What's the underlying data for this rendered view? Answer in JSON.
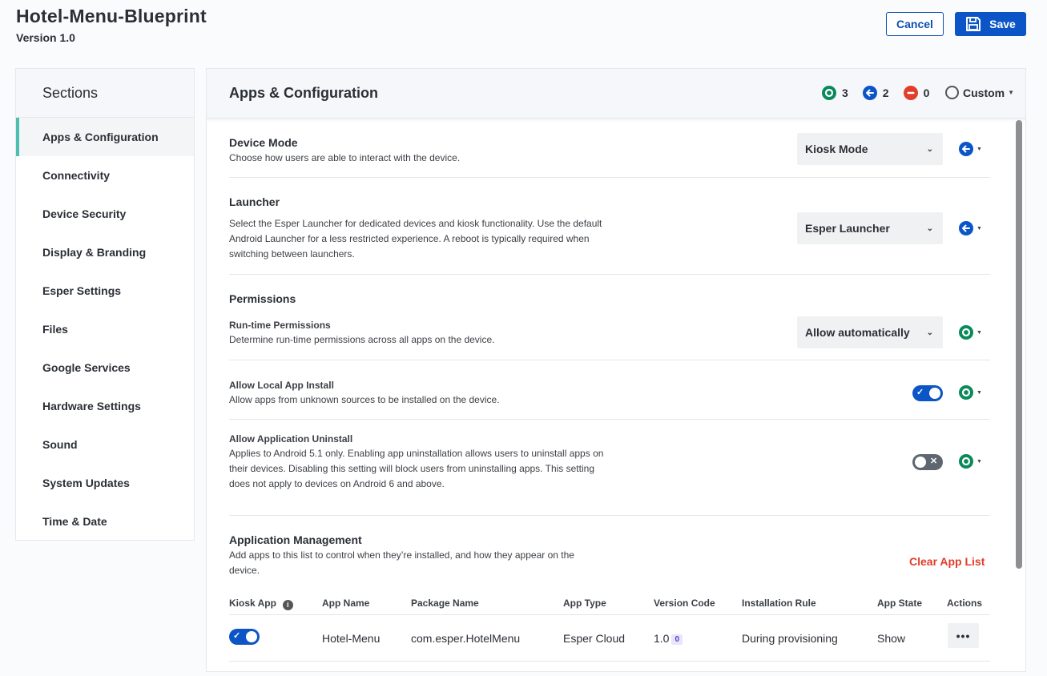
{
  "header": {
    "title": "Hotel-Menu-Blueprint",
    "version": "Version 1.0",
    "cancel_label": "Cancel",
    "save_label": "Save"
  },
  "sidebar": {
    "title": "Sections",
    "items": [
      {
        "label": "Apps & Configuration",
        "active": true
      },
      {
        "label": "Connectivity"
      },
      {
        "label": "Device Security"
      },
      {
        "label": "Display & Branding"
      },
      {
        "label": "Esper Settings"
      },
      {
        "label": "Files"
      },
      {
        "label": "Google Services"
      },
      {
        "label": "Hardware Settings"
      },
      {
        "label": "Sound"
      },
      {
        "label": "System Updates"
      },
      {
        "label": "Time & Date"
      }
    ]
  },
  "main": {
    "title": "Apps & Configuration",
    "counts": {
      "green": "3",
      "blue": "2",
      "red": "0"
    },
    "custom_label": "Custom",
    "device_mode": {
      "title": "Device Mode",
      "desc": "Choose how users are able to interact with the device.",
      "value": "Kiosk Mode",
      "status": "blue-arrow-icon"
    },
    "launcher": {
      "title": "Launcher",
      "desc": "Select the Esper Launcher for dedicated devices and kiosk functionality. Use the default Android Launcher for a less restricted experience. A reboot is typically required when switching between launchers.",
      "value": "Esper Launcher",
      "status": "blue-arrow-icon"
    },
    "permissions": {
      "title": "Permissions",
      "runtime": {
        "title": "Run-time Permissions",
        "desc": "Determine run-time permissions across all apps on the device.",
        "value": "Allow automatically",
        "status": "green-ring-icon"
      },
      "local_install": {
        "title": "Allow Local App Install",
        "desc": "Allow apps from unknown sources to be installed on the device.",
        "enabled": true,
        "status": "green-ring-icon"
      },
      "uninstall": {
        "title": "Allow Application Uninstall",
        "desc": "Applies to Android 5.1 only. Enabling app uninstallation allows users to uninstall apps on their devices. Disabling this setting will block users from uninstalling apps. This setting does not apply to devices on Android 6 and above.",
        "enabled": false,
        "status": "green-ring-icon"
      }
    },
    "app_management": {
      "title": "Application Management",
      "desc": "Add apps to this list to control when they’re installed, and how they appear on the device.",
      "clear_label": "Clear App List",
      "columns": [
        "Kiosk App",
        "App Name",
        "Package Name",
        "App Type",
        "Version Code",
        "Installation Rule",
        "App State",
        "Actions"
      ],
      "rows": [
        {
          "kiosk": true,
          "app_name": "Hotel-Menu",
          "package": "com.esper.HotelMenu",
          "app_type": "Esper Cloud",
          "version": "1.0",
          "version_badge": "0",
          "install_rule": "During provisioning",
          "app_state": "Show",
          "actions_label": "•••"
        }
      ]
    }
  },
  "colors": {
    "primary": "#0b55c6",
    "green": "#0a8a5a",
    "red": "#e13d2a",
    "accent_bar": "#4dc0b0"
  }
}
